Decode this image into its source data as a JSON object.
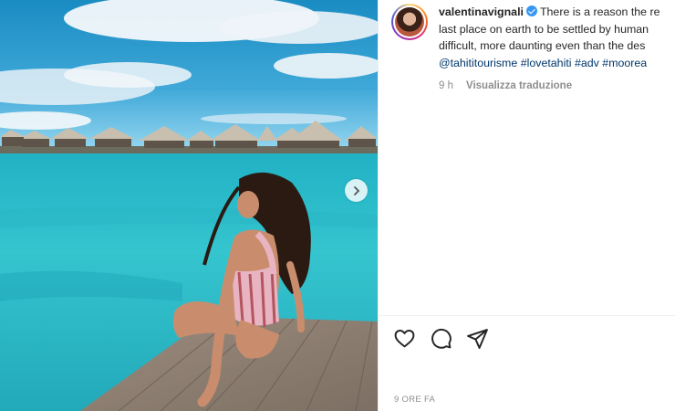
{
  "post": {
    "username": "valentinavignali",
    "verified": true,
    "caption_lines": [
      "There is a reason the re",
      "last place on earth to be settled by human",
      "difficult, more daunting even than the des"
    ],
    "tags": [
      "@tahititourisme",
      "#lovetahiti",
      "#adv",
      "#moorea"
    ],
    "relative_time": "9 h",
    "translate_label": "Visualizza traduzione",
    "timestamp": "9 ORE FA"
  },
  "icons": {
    "like": "heart-icon",
    "comment": "comment-icon",
    "share": "share-icon",
    "next": "chevron-right-icon",
    "verified": "verified-badge-icon"
  },
  "colors": {
    "link": "#00376b",
    "verified": "#3897f0",
    "muted": "#8e8e8e"
  }
}
